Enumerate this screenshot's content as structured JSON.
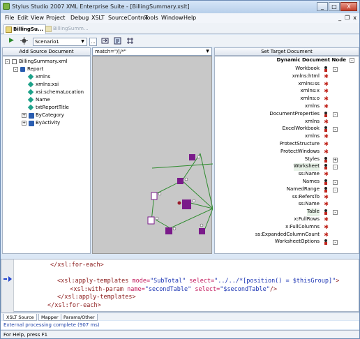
{
  "window": {
    "title": "Stylus Studio 2007 XML Enterprise Suite - [BillingSummary.xslt]",
    "min_label": "_",
    "max_label": "□",
    "close_label": "X"
  },
  "menu": [
    "File",
    "Edit",
    "View",
    "Project",
    "Debug",
    "XSLT",
    "SourceControl",
    "Tools",
    "Window",
    "Help"
  ],
  "mdi_controls": {
    "min": "_",
    "restore": "❐",
    "close": "x"
  },
  "doc_tabs": [
    {
      "label": "BillingSu..."
    },
    {
      "label": "BillingSumm..."
    }
  ],
  "toolbar": {
    "run_glyph": "▶",
    "scenario_value": "Scenario1",
    "arrow_glyph": "▼",
    "browse_label": "..."
  },
  "left_pane": {
    "header": "Add Source Document",
    "tree": [
      {
        "label": "BillingSummary.xml",
        "icon": "document-icon",
        "level": 0,
        "expander": "-"
      },
      {
        "label": "Report",
        "icon": "element-icon",
        "level": 1,
        "expander": "-"
      },
      {
        "label": "xmlns",
        "icon": "attribute-icon",
        "level": 2
      },
      {
        "label": "xmlns:xsi",
        "icon": "attribute-icon",
        "level": 2
      },
      {
        "label": "xsi:schemaLocation",
        "icon": "attribute-icon",
        "level": 2
      },
      {
        "label": "Name",
        "icon": "attribute-icon",
        "level": 2
      },
      {
        "label": "txtReportTitle",
        "icon": "attribute-icon",
        "level": 2
      },
      {
        "label": "ByCategory",
        "icon": "element-group-icon",
        "level": 2,
        "expander": "+"
      },
      {
        "label": "ByActivity",
        "icon": "element-group-icon",
        "level": 2,
        "expander": "+"
      }
    ]
  },
  "mapper": {
    "match_value": "match=\"/|/*\""
  },
  "right_pane": {
    "header": "Set Target Document",
    "root": "Dynamic Document Node",
    "tree": [
      {
        "label": "Workbook",
        "kind": "element",
        "expander": "-"
      },
      {
        "label": "xmlns:html",
        "kind": "attr"
      },
      {
        "label": "xmlns:ss",
        "kind": "attr"
      },
      {
        "label": "xmlns:x",
        "kind": "attr"
      },
      {
        "label": "xmlns:o",
        "kind": "attr"
      },
      {
        "label": "xmlns",
        "kind": "attr"
      },
      {
        "label": "DocumentProperties",
        "kind": "element",
        "expander": "-"
      },
      {
        "label": "xmlns",
        "kind": "attr"
      },
      {
        "label": "ExcelWorkbook",
        "kind": "element",
        "expander": "-"
      },
      {
        "label": "xmlns",
        "kind": "attr"
      },
      {
        "label": "ProtectStructure",
        "kind": "attr"
      },
      {
        "label": "ProtectWindows",
        "kind": "attr"
      },
      {
        "label": "Styles",
        "kind": "element",
        "expander": "+"
      },
      {
        "label": "Worksheet",
        "kind": "element",
        "expander": "-"
      },
      {
        "label": "ss:Name",
        "kind": "attr"
      },
      {
        "label": "Names",
        "kind": "element",
        "expander": "-"
      },
      {
        "label": "NamedRange",
        "kind": "element",
        "expander": "-"
      },
      {
        "label": "ss:RefersTo",
        "kind": "attr"
      },
      {
        "label": "ss:Name",
        "kind": "attr"
      },
      {
        "label": "Table",
        "kind": "element",
        "expander": "-"
      },
      {
        "label": "x:FullRows",
        "kind": "attr"
      },
      {
        "label": "x:FullColumns",
        "kind": "attr"
      },
      {
        "label": "ss:ExpandedColumnCount",
        "kind": "attr"
      },
      {
        "label": "WorksheetOptions",
        "kind": "element",
        "expander": "-"
      }
    ]
  },
  "editor": {
    "lines": [
      {
        "parts": [
          {
            "c": "tag",
            "t": "</xsl:for-each>"
          }
        ]
      },
      {
        "parts": []
      },
      {
        "parts": [
          {
            "c": "tag",
            "t": "<xsl:apply-templates "
          },
          {
            "c": "att",
            "t": "mode="
          },
          {
            "c": "val",
            "t": "\"SubTotal\" "
          },
          {
            "c": "att",
            "t": "select="
          },
          {
            "c": "val",
            "t": "\"../../*[position() = $thisGroup]\""
          },
          {
            "c": "tag",
            "t": ">"
          }
        ]
      },
      {
        "parts": [
          {
            "c": "tag",
            "t": "  <xsl:with-param "
          },
          {
            "c": "att",
            "t": "name="
          },
          {
            "c": "val",
            "t": "\"secondTable\" "
          },
          {
            "c": "att",
            "t": "select="
          },
          {
            "c": "val",
            "t": "\"$secondTable\""
          },
          {
            "c": "tag",
            "t": "/>"
          }
        ]
      },
      {
        "parts": [
          {
            "c": "tag",
            "t": "</xsl:apply-templates>"
          }
        ]
      },
      {
        "parts": [
          {
            "c": "tag",
            "t": "</xsl:for-each>"
          }
        ]
      }
    ]
  },
  "bottom_tabs": [
    "XSLT Source",
    "Mapper",
    "Params/Other"
  ],
  "output_message": "External processing complete (907 ms)",
  "status_text": "For Help, press F1",
  "colors": {
    "element": "#2a5db0",
    "attribute": "#1ea28a",
    "mapper_bg": "#c8c8c8",
    "link": "#2e8b2e",
    "node": "#7a1a8a",
    "star": "#c0241c"
  }
}
